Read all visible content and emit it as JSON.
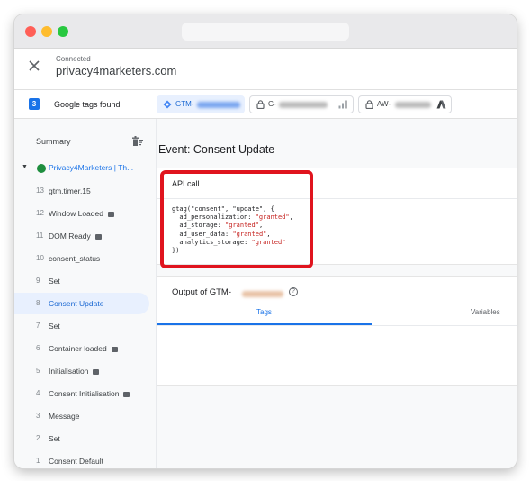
{
  "header": {
    "status": "Connected",
    "domain": "privacy4marketers.com"
  },
  "tags_bar": {
    "count": "3",
    "label": "Google tags found",
    "chips": [
      {
        "prefix": "GTM-",
        "active": true
      },
      {
        "prefix": "G-",
        "active": false
      },
      {
        "prefix": "AW-",
        "active": false
      }
    ]
  },
  "sidebar": {
    "summary": "Summary",
    "container": "Privacy4Marketers | Th...",
    "events": [
      {
        "num": "13",
        "name": "gtm.timer.15",
        "tag": false,
        "selected": false
      },
      {
        "num": "12",
        "name": "Window Loaded",
        "tag": true,
        "selected": false
      },
      {
        "num": "11",
        "name": "DOM Ready",
        "tag": true,
        "selected": false
      },
      {
        "num": "10",
        "name": "consent_status",
        "tag": false,
        "selected": false
      },
      {
        "num": "9",
        "name": "Set",
        "tag": false,
        "selected": false
      },
      {
        "num": "8",
        "name": "Consent Update",
        "tag": false,
        "selected": true
      },
      {
        "num": "7",
        "name": "Set",
        "tag": false,
        "selected": false
      },
      {
        "num": "6",
        "name": "Container loaded",
        "tag": true,
        "selected": false
      },
      {
        "num": "5",
        "name": "Initialisation",
        "tag": true,
        "selected": false
      },
      {
        "num": "4",
        "name": "Consent Initialisation",
        "tag": true,
        "selected": false
      },
      {
        "num": "3",
        "name": "Message",
        "tag": false,
        "selected": false
      },
      {
        "num": "2",
        "name": "Set",
        "tag": false,
        "selected": false
      },
      {
        "num": "1",
        "name": "Consent Default",
        "tag": false,
        "selected": false
      }
    ]
  },
  "main": {
    "event_title": "Event: Consent Update",
    "api_card": {
      "title": "API call",
      "code": {
        "open": "gtag(\"consent\", \"update\", {",
        "lines": [
          {
            "key": "  ad_personalization: ",
            "value": "\"granted\"",
            "tail": ","
          },
          {
            "key": "  ad_storage: ",
            "value": "\"granted\"",
            "tail": ","
          },
          {
            "key": "  ad_user_data: ",
            "value": "\"granted\"",
            "tail": ","
          },
          {
            "key": "  analytics_storage: ",
            "value": "\"granted\"",
            "tail": ""
          }
        ],
        "close": "})"
      }
    },
    "output_card": {
      "title": "Output of GTM-",
      "help": "?",
      "tabs": [
        "Tags",
        "Variables"
      ]
    }
  },
  "colors": {
    "accent": "#1a73e8",
    "selected_bg": "#e8f0fe",
    "highlight": "#e0141e",
    "string": "#c5221f",
    "connected": "#1e8e3e"
  }
}
